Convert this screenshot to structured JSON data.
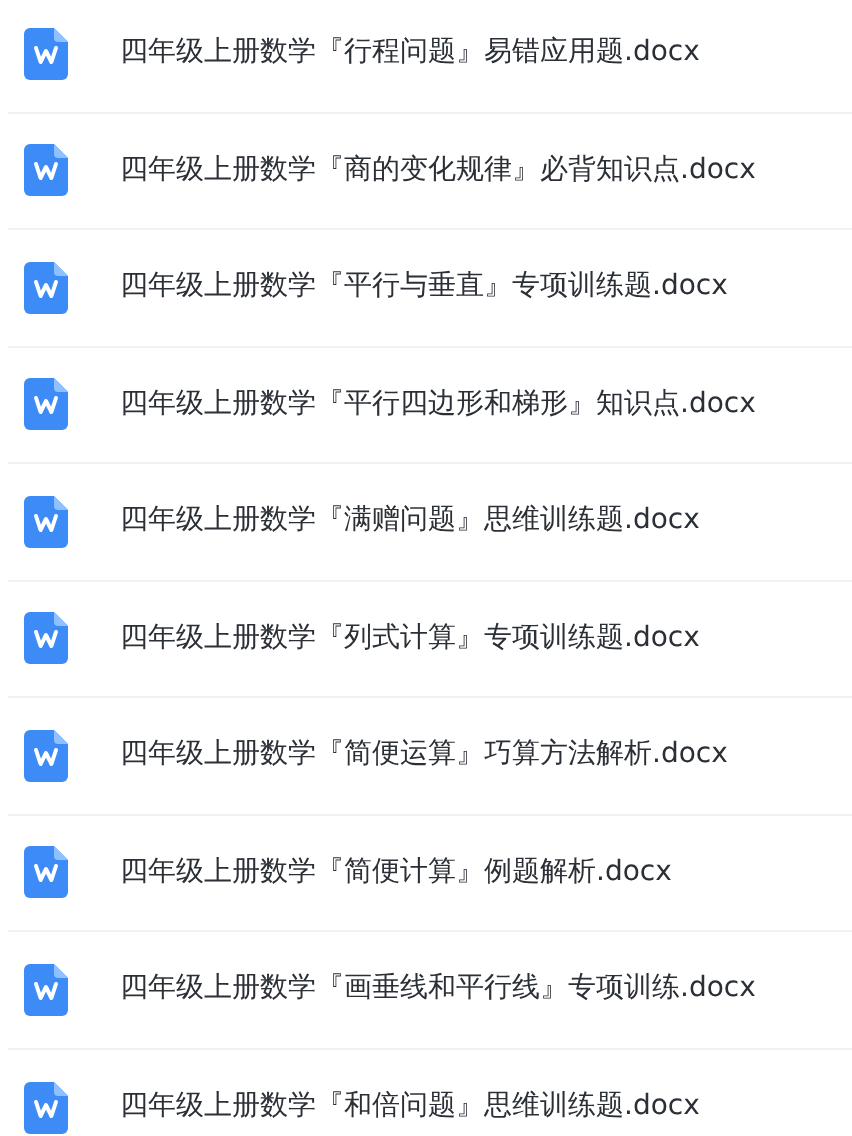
{
  "files": [
    {
      "name": "四年级上册数学『行程问题』易错应用题.docx"
    },
    {
      "name": "四年级上册数学『商的变化规律』必背知识点.docx"
    },
    {
      "name": "四年级上册数学『平行与垂直』专项训练题.docx"
    },
    {
      "name": "四年级上册数学『平行四边形和梯形』知识点.docx"
    },
    {
      "name": "四年级上册数学『满赠问题』思维训练题.docx"
    },
    {
      "name": "四年级上册数学『列式计算』专项训练题.docx"
    },
    {
      "name": "四年级上册数学『简便运算』巧算方法解析.docx"
    },
    {
      "name": "四年级上册数学『简便计算』例题解析.docx"
    },
    {
      "name": "四年级上册数学『画垂线和平行线』专项训练.docx"
    },
    {
      "name": "四年级上册数学『和倍问题』思维训练题.docx"
    }
  ]
}
